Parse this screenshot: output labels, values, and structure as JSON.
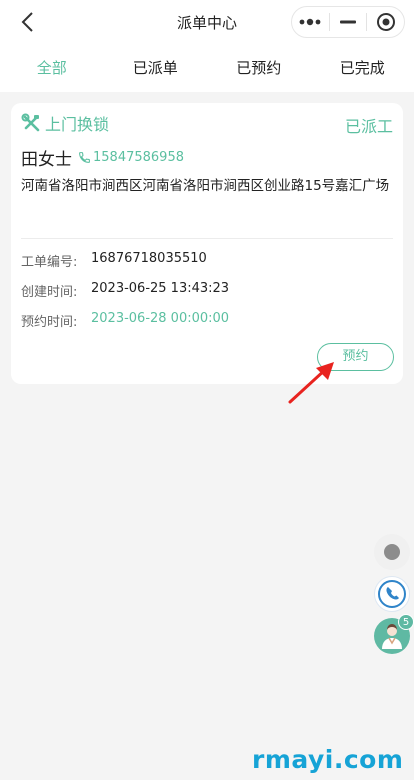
{
  "navbar": {
    "title": "派单中心",
    "back_icon": "chevron-left-icon",
    "capsule": {
      "more_icon": "more-dots-icon",
      "minimize_icon": "minimize-icon",
      "close_icon": "target-icon"
    }
  },
  "tabs": [
    {
      "label": "全部",
      "active": true
    },
    {
      "label": "已派单",
      "active": false
    },
    {
      "label": "已预约",
      "active": false
    },
    {
      "label": "已完成",
      "active": false
    }
  ],
  "order": {
    "service_icon": "tools-icon",
    "service": "上门换锁",
    "status": "已派工",
    "customer_name": "田女士",
    "phone_icon": "phone-icon",
    "phone": "15847586958",
    "address": "河南省洛阳市涧西区河南省洛阳市涧西区创业路15号嘉汇广场",
    "fields": [
      {
        "label": "工单编号:",
        "value": "16876718035510"
      },
      {
        "label": "创建时间:",
        "value": "2023-06-25 13:43:23"
      },
      {
        "label": "预约时间:",
        "value": "2023-06-28 00:00:00"
      }
    ],
    "book_button": "预约"
  },
  "floating": {
    "record_icon": "record-icon",
    "phone_icon": "phone-icon",
    "kefu_icon": "customer-service-avatar-icon",
    "badge_count": "5"
  },
  "watermark": "rmayi.com",
  "colors": {
    "accent": "#5bbfa0",
    "annotation_arrow": "#e8231f",
    "watermark": "#16a3d6"
  }
}
